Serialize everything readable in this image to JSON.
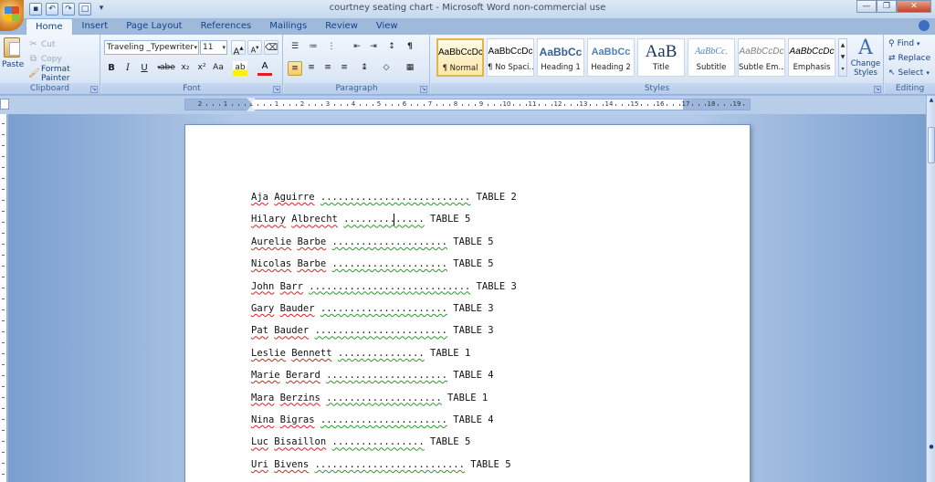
{
  "window": {
    "title": "courtney seating chart - Microsoft Word non-commercial use"
  },
  "tabs": [
    {
      "label": "Home",
      "active": true
    },
    {
      "label": "Insert"
    },
    {
      "label": "Page Layout"
    },
    {
      "label": "References"
    },
    {
      "label": "Mailings"
    },
    {
      "label": "Review"
    },
    {
      "label": "View"
    }
  ],
  "clipboard": {
    "group_label": "Clipboard",
    "paste_label": "Paste",
    "cut_label": "Cut",
    "copy_label": "Copy",
    "format_painter_label": "Format Painter"
  },
  "font": {
    "group_label": "Font",
    "font_name": "Traveling _Typewriter",
    "font_size": "11",
    "bold": "B",
    "italic": "I",
    "underline": "U",
    "strike": "abe",
    "subscript": "x₂",
    "superscript": "x²",
    "change_case": "Aa",
    "grow": "A",
    "shrink": "A",
    "font_color_glyph": "A"
  },
  "paragraph": {
    "group_label": "Paragraph",
    "pilcrow": "¶"
  },
  "styles": {
    "group_label": "Styles",
    "items": [
      {
        "sample": "AaBbCcDc",
        "name": "¶ Normal",
        "active": true
      },
      {
        "sample": "AaBbCcDc",
        "name": "¶ No Spaci..."
      },
      {
        "sample": "AaBbCc",
        "name": "Heading 1"
      },
      {
        "sample": "AaBbCc",
        "name": "Heading 2"
      },
      {
        "sample": "AaB",
        "name": "Title"
      },
      {
        "sample": "AaBbCc.",
        "name": "Subtitle"
      },
      {
        "sample": "AaBbCcDc",
        "name": "Subtle Em..."
      },
      {
        "sample": "AaBbCcDc",
        "name": "Emphasis"
      }
    ],
    "change_styles_label": "Change Styles"
  },
  "editing": {
    "group_label": "Editing",
    "find_label": "Find",
    "replace_label": "Replace",
    "select_label": "Select"
  },
  "ruler": {
    "numbers": [
      "2",
      "1",
      "1",
      "1",
      "2",
      "3",
      "4",
      "5",
      "6",
      "7",
      "8",
      "9",
      "10",
      "11",
      "12",
      "13",
      "14",
      "15",
      "16",
      "17",
      "18",
      "19"
    ]
  },
  "document": {
    "lines": [
      {
        "first": "Aja",
        "last": "Aguirre",
        "dots": "..........................",
        "table": "TABLE 2"
      },
      {
        "first": "Hilary",
        "last": "Albrecht",
        "dots": "..............",
        "table": "TABLE 5"
      },
      {
        "first": "Aurelie",
        "last": "Barbe",
        "dots": "....................",
        "table": "TABLE 5"
      },
      {
        "first": "Nicolas",
        "last": "Barbe",
        "dots": "....................",
        "table": "TABLE 5"
      },
      {
        "first": "John",
        "last": "Barr",
        "dots": "............................",
        "table": "TABLE 3"
      },
      {
        "first": "Gary",
        "last": "Bauder",
        "dots": "......................",
        "table": "TABLE 3"
      },
      {
        "first": "Pat",
        "last": "Bauder",
        "dots": ".......................",
        "table": "TABLE 3"
      },
      {
        "first": "Leslie",
        "last": "Bennett",
        "dots": "...............",
        "table": "TABLE 1"
      },
      {
        "first": "Marie",
        "last": "Berard",
        "dots": ".....................",
        "table": "TABLE 4"
      },
      {
        "first": "Mara",
        "last": "Berzins",
        "dots": "....................",
        "table": "TABLE 1"
      },
      {
        "first": "Nina",
        "last": "Bigras",
        "dots": "......................",
        "table": "TABLE 4"
      },
      {
        "first": "Luc",
        "last": "Bisaillon",
        "dots": "................",
        "table": "TABLE 5"
      },
      {
        "first": "Uri",
        "last": "Bivens",
        "dots": "..........................",
        "table": "TABLE 5"
      }
    ]
  }
}
